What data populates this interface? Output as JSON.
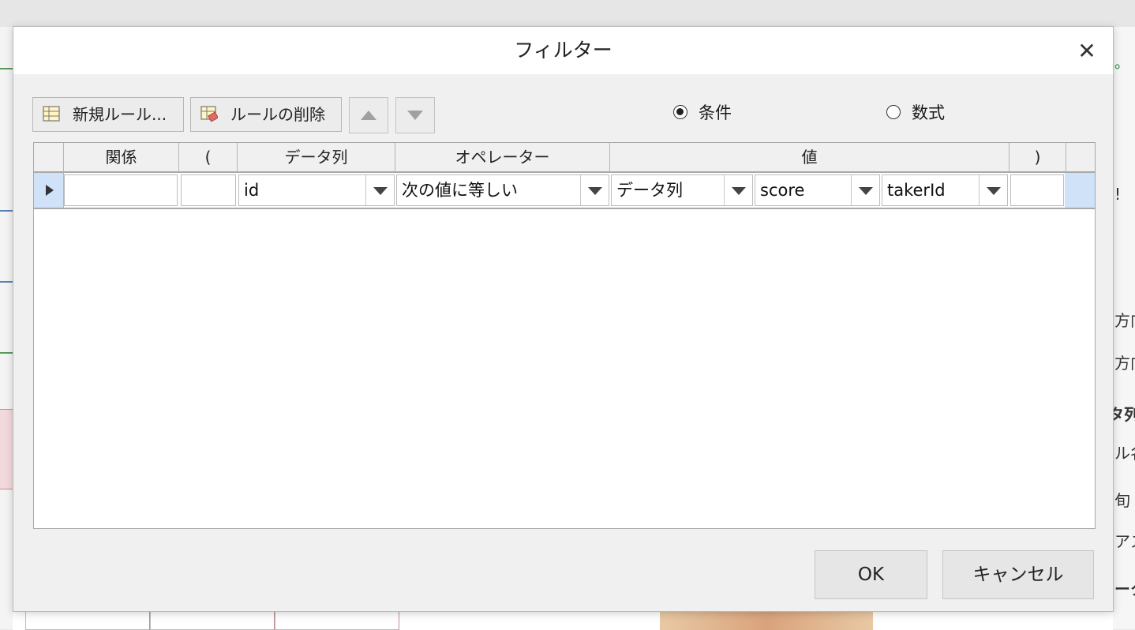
{
  "background": {
    "right_fragments": [
      "゜レ",
      "!",
      "方向",
      "方向",
      "タ列",
      "ル名",
      "旬",
      "アス",
      "ータ"
    ]
  },
  "dialog": {
    "title": "フィルター",
    "close_glyph": "✕",
    "toolbar": {
      "new_rule_label": "新規ルール...",
      "delete_rule_label": "ルールの削除"
    },
    "mode": {
      "options": [
        {
          "label": "条件",
          "selected": true
        },
        {
          "label": "数式",
          "selected": false
        }
      ]
    },
    "grid": {
      "columns": [
        "関係",
        "(",
        "データ列",
        "オペレーター",
        "値",
        ")"
      ],
      "rows": [
        {
          "relation": "",
          "open_paren": "",
          "column": "id",
          "operator": "次の値に等しい",
          "value_type": "データ列",
          "value_table": "score",
          "value_column": "takerId",
          "close_paren": ""
        }
      ]
    },
    "buttons": {
      "ok": "OK",
      "cancel": "キャンセル"
    }
  }
}
